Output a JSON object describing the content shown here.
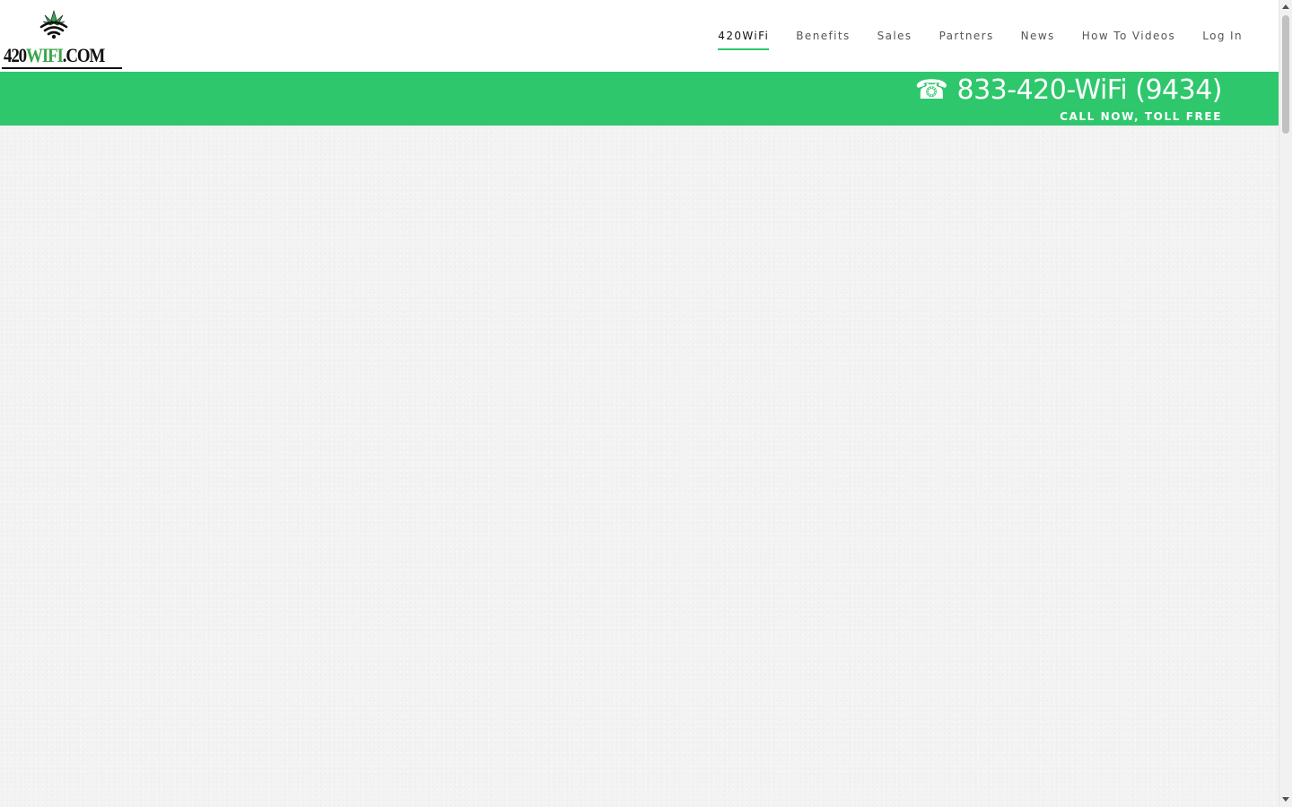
{
  "logo": {
    "text_prefix": "420",
    "text_wifi": "WIFI",
    "text_suffix": ".COM",
    "icon": "cannabis-wifi-icon"
  },
  "nav": {
    "items": [
      {
        "label": "420WiFi",
        "active": true
      },
      {
        "label": "Benefits",
        "active": false
      },
      {
        "label": "Sales",
        "active": false
      },
      {
        "label": "Partners",
        "active": false
      },
      {
        "label": "News",
        "active": false
      },
      {
        "label": "How To Videos",
        "active": false
      },
      {
        "label": "Log In",
        "active": false
      }
    ]
  },
  "phone": {
    "icon": "phone-icon",
    "glyph": "☎",
    "number": "833-420-WiFi (9434)",
    "subtitle": "CALL NOW, TOLL FREE"
  },
  "colors": {
    "accent": "#2ec76c",
    "background": "#f3f3f3",
    "logo_green": "#3aa64a"
  }
}
